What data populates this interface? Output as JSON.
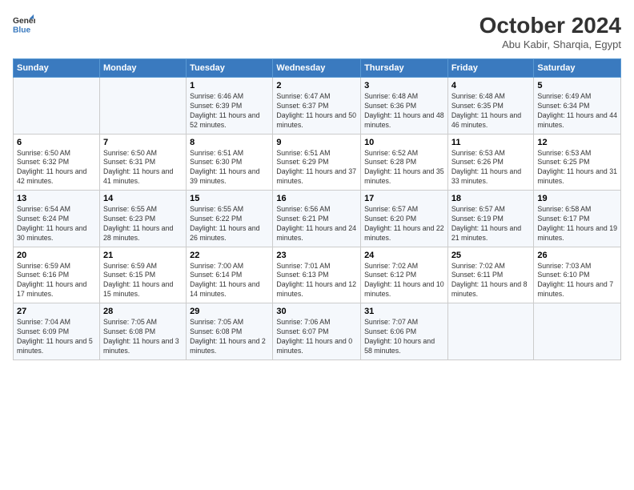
{
  "logo": {
    "line1": "General",
    "line2": "Blue"
  },
  "title": "October 2024",
  "location": "Abu Kabir, Sharqia, Egypt",
  "days_of_week": [
    "Sunday",
    "Monday",
    "Tuesday",
    "Wednesday",
    "Thursday",
    "Friday",
    "Saturday"
  ],
  "weeks": [
    [
      {
        "day": "",
        "info": ""
      },
      {
        "day": "",
        "info": ""
      },
      {
        "day": "1",
        "info": "Sunrise: 6:46 AM\nSunset: 6:39 PM\nDaylight: 11 hours and 52 minutes."
      },
      {
        "day": "2",
        "info": "Sunrise: 6:47 AM\nSunset: 6:37 PM\nDaylight: 11 hours and 50 minutes."
      },
      {
        "day": "3",
        "info": "Sunrise: 6:48 AM\nSunset: 6:36 PM\nDaylight: 11 hours and 48 minutes."
      },
      {
        "day": "4",
        "info": "Sunrise: 6:48 AM\nSunset: 6:35 PM\nDaylight: 11 hours and 46 minutes."
      },
      {
        "day": "5",
        "info": "Sunrise: 6:49 AM\nSunset: 6:34 PM\nDaylight: 11 hours and 44 minutes."
      }
    ],
    [
      {
        "day": "6",
        "info": "Sunrise: 6:50 AM\nSunset: 6:32 PM\nDaylight: 11 hours and 42 minutes."
      },
      {
        "day": "7",
        "info": "Sunrise: 6:50 AM\nSunset: 6:31 PM\nDaylight: 11 hours and 41 minutes."
      },
      {
        "day": "8",
        "info": "Sunrise: 6:51 AM\nSunset: 6:30 PM\nDaylight: 11 hours and 39 minutes."
      },
      {
        "day": "9",
        "info": "Sunrise: 6:51 AM\nSunset: 6:29 PM\nDaylight: 11 hours and 37 minutes."
      },
      {
        "day": "10",
        "info": "Sunrise: 6:52 AM\nSunset: 6:28 PM\nDaylight: 11 hours and 35 minutes."
      },
      {
        "day": "11",
        "info": "Sunrise: 6:53 AM\nSunset: 6:26 PM\nDaylight: 11 hours and 33 minutes."
      },
      {
        "day": "12",
        "info": "Sunrise: 6:53 AM\nSunset: 6:25 PM\nDaylight: 11 hours and 31 minutes."
      }
    ],
    [
      {
        "day": "13",
        "info": "Sunrise: 6:54 AM\nSunset: 6:24 PM\nDaylight: 11 hours and 30 minutes."
      },
      {
        "day": "14",
        "info": "Sunrise: 6:55 AM\nSunset: 6:23 PM\nDaylight: 11 hours and 28 minutes."
      },
      {
        "day": "15",
        "info": "Sunrise: 6:55 AM\nSunset: 6:22 PM\nDaylight: 11 hours and 26 minutes."
      },
      {
        "day": "16",
        "info": "Sunrise: 6:56 AM\nSunset: 6:21 PM\nDaylight: 11 hours and 24 minutes."
      },
      {
        "day": "17",
        "info": "Sunrise: 6:57 AM\nSunset: 6:20 PM\nDaylight: 11 hours and 22 minutes."
      },
      {
        "day": "18",
        "info": "Sunrise: 6:57 AM\nSunset: 6:19 PM\nDaylight: 11 hours and 21 minutes."
      },
      {
        "day": "19",
        "info": "Sunrise: 6:58 AM\nSunset: 6:17 PM\nDaylight: 11 hours and 19 minutes."
      }
    ],
    [
      {
        "day": "20",
        "info": "Sunrise: 6:59 AM\nSunset: 6:16 PM\nDaylight: 11 hours and 17 minutes."
      },
      {
        "day": "21",
        "info": "Sunrise: 6:59 AM\nSunset: 6:15 PM\nDaylight: 11 hours and 15 minutes."
      },
      {
        "day": "22",
        "info": "Sunrise: 7:00 AM\nSunset: 6:14 PM\nDaylight: 11 hours and 14 minutes."
      },
      {
        "day": "23",
        "info": "Sunrise: 7:01 AM\nSunset: 6:13 PM\nDaylight: 11 hours and 12 minutes."
      },
      {
        "day": "24",
        "info": "Sunrise: 7:02 AM\nSunset: 6:12 PM\nDaylight: 11 hours and 10 minutes."
      },
      {
        "day": "25",
        "info": "Sunrise: 7:02 AM\nSunset: 6:11 PM\nDaylight: 11 hours and 8 minutes."
      },
      {
        "day": "26",
        "info": "Sunrise: 7:03 AM\nSunset: 6:10 PM\nDaylight: 11 hours and 7 minutes."
      }
    ],
    [
      {
        "day": "27",
        "info": "Sunrise: 7:04 AM\nSunset: 6:09 PM\nDaylight: 11 hours and 5 minutes."
      },
      {
        "day": "28",
        "info": "Sunrise: 7:05 AM\nSunset: 6:08 PM\nDaylight: 11 hours and 3 minutes."
      },
      {
        "day": "29",
        "info": "Sunrise: 7:05 AM\nSunset: 6:08 PM\nDaylight: 11 hours and 2 minutes."
      },
      {
        "day": "30",
        "info": "Sunrise: 7:06 AM\nSunset: 6:07 PM\nDaylight: 11 hours and 0 minutes."
      },
      {
        "day": "31",
        "info": "Sunrise: 7:07 AM\nSunset: 6:06 PM\nDaylight: 10 hours and 58 minutes."
      },
      {
        "day": "",
        "info": ""
      },
      {
        "day": "",
        "info": ""
      }
    ]
  ]
}
